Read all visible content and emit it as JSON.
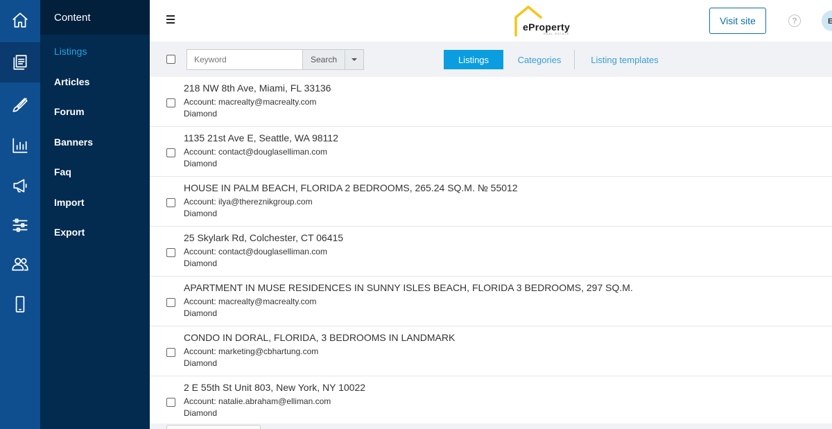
{
  "sidebar": {
    "icons": [
      "home-icon",
      "content-icon",
      "brush-icon",
      "chart-icon",
      "megaphone-icon",
      "sliders-icon",
      "users-icon",
      "mobile-icon"
    ],
    "section_title": "Content",
    "items": [
      {
        "label": "Listings",
        "active": true
      },
      {
        "label": "Articles"
      },
      {
        "label": "Forum"
      },
      {
        "label": "Banners"
      },
      {
        "label": "Faq"
      },
      {
        "label": "Import"
      },
      {
        "label": "Export"
      }
    ]
  },
  "header": {
    "logo_text": "eProperty",
    "logo_subtext": "REAL ESTATE",
    "visit_label": "Visit site",
    "help_icon": "?",
    "avatar_initial": "E"
  },
  "toolbar": {
    "search_placeholder": "Keyword",
    "search_label": "Search",
    "tabs": [
      {
        "label": "Listings",
        "active": true
      },
      {
        "label": "Categories"
      },
      {
        "label": "Listing templates"
      }
    ]
  },
  "listings": [
    {
      "title": "218 NW 8th Ave, Miami, FL 33136",
      "account": "Account: macrealty@macrealty.com",
      "plan": "Diamond"
    },
    {
      "title": "1135 21st Ave E, Seattle, WA 98112",
      "account": "Account: contact@douglaselliman.com",
      "plan": "Diamond"
    },
    {
      "title": "HOUSE IN PALM BEACH, FLORIDA 2 BEDROOMS, 265.24 SQ.M. № 55012",
      "account": "Account: ilya@thereznikgroup.com",
      "plan": "Diamond"
    },
    {
      "title": "25 Skylark Rd, Colchester, CT 06415",
      "account": "Account: contact@douglaselliman.com",
      "plan": "Diamond"
    },
    {
      "title": "APARTMENT IN MUSE RESIDENCES IN SUNNY ISLES BEACH, FLORIDA 3 BEDROOMS, 297 SQ.M.",
      "account": "Account: macrealty@macrealty.com",
      "plan": "Diamond"
    },
    {
      "title": "CONDO IN DORAL, FLORIDA, 3 BEDROOMS IN LANDMARK",
      "account": "Account: marketing@cbhartung.com",
      "plan": "Diamond"
    },
    {
      "title": "2 E 55th St Unit 803, New York, NY 10022",
      "account": "Account: natalie.abraham@elliman.com",
      "plan": "Diamond"
    }
  ],
  "colors": {
    "rail": "#0f4f8f",
    "subnav": "#032a4f",
    "accent": "#0a9ee0",
    "link": "#3a9dd6",
    "logo_roof": "#f5c518"
  }
}
